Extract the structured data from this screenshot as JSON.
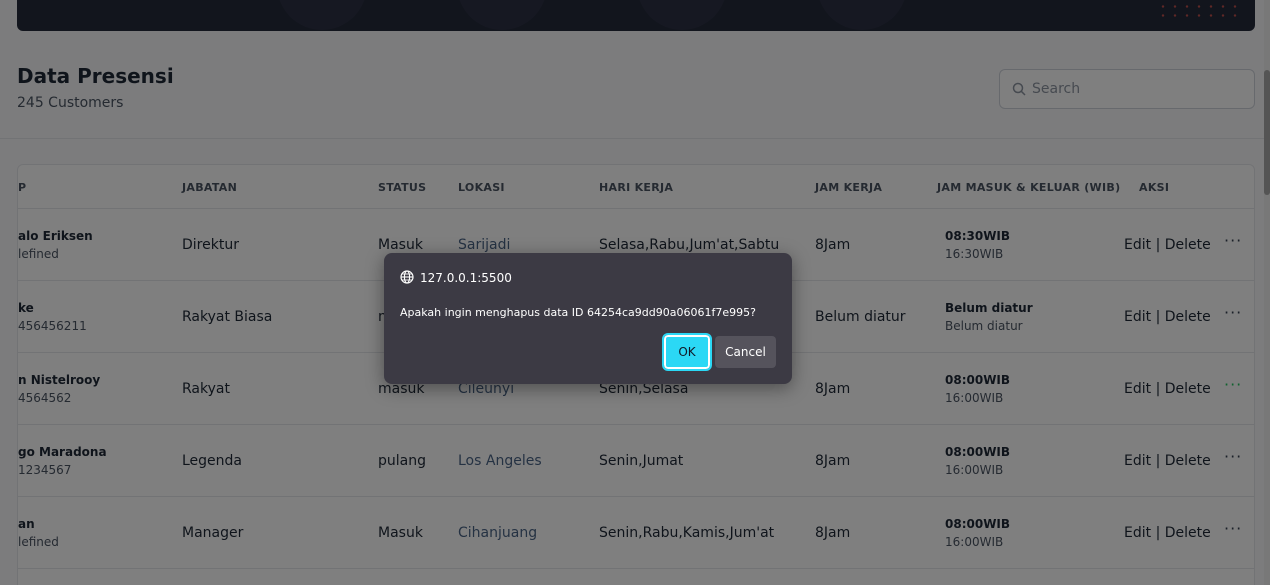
{
  "header": {
    "title": "Data Presensi",
    "subtitle": "245 Customers"
  },
  "search": {
    "placeholder": "Search"
  },
  "table": {
    "columns": [
      "P",
      "JABATAN",
      "STATUS",
      "LOKASI",
      "HARI KERJA",
      "JAM KERJA",
      "JAM MASUK & KELUAR (WIB)",
      "AKSI"
    ],
    "rows": [
      {
        "name": "alo Eriksen",
        "nip": "lefined",
        "jabatan": "Direktur",
        "status": "Masuk",
        "lokasi": "Sarijadi",
        "hari": "Selasa,Rabu,Jum'at,Sabtu",
        "jam": "8Jam",
        "masuk": "08:30WIB",
        "keluar": "16:30WIB"
      },
      {
        "name": "ke",
        "nip": "456456211",
        "jabatan": "Rakyat Biasa",
        "status": "m",
        "lokasi": "",
        "hari": "",
        "jam": "Belum diatur",
        "masuk": "Belum diatur",
        "keluar": "Belum diatur"
      },
      {
        "name": "n Nistelrooy",
        "nip": "4564562",
        "jabatan": "Rakyat",
        "status": "masuk",
        "lokasi": "Cileunyi",
        "hari": "Senin,Selasa",
        "jam": "8Jam",
        "masuk": "08:00WIB",
        "keluar": "16:00WIB"
      },
      {
        "name": "go Maradona",
        "nip": "1234567",
        "jabatan": "Legenda",
        "status": "pulang",
        "lokasi": "Los Angeles",
        "hari": "Senin,Jumat",
        "jam": "8Jam",
        "masuk": "08:00WIB",
        "keluar": "16:00WIB"
      },
      {
        "name": "an",
        "nip": "lefined",
        "jabatan": "Manager",
        "status": "Masuk",
        "lokasi": "Cihanjuang",
        "hari": "Senin,Rabu,Kamis,Jum'at",
        "jam": "8Jam",
        "masuk": "08:00WIB",
        "keluar": "16:00WIB"
      }
    ],
    "action_edit": "Edit",
    "action_sep": " | ",
    "action_delete": "Delete",
    "more_label": "···"
  },
  "dialog": {
    "origin": "127.0.0.1:5500",
    "message": "Apakah ingin menghapus data ID 64254ca9dd90a06061f7e995?",
    "ok_label": "OK",
    "cancel_label": "Cancel"
  },
  "colors": {
    "dialog_bg": "#3c3a44",
    "ok_accent": "#2bd8f5",
    "banner_bg": "#252a3b"
  },
  "icons": [
    "search-icon",
    "globe-icon",
    "more-icon"
  ]
}
